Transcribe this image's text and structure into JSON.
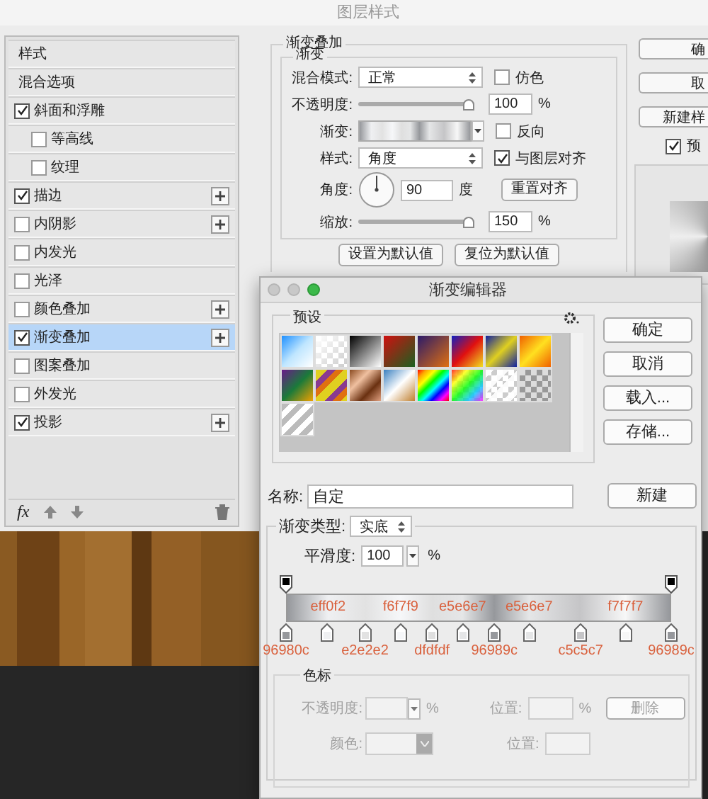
{
  "window": {
    "title": "图层样式"
  },
  "styles_list": {
    "items": [
      {
        "label": "样式",
        "kind": "header",
        "selected": false,
        "add_button": false
      },
      {
        "label": "混合选项",
        "kind": "header",
        "selected": false,
        "add_button": false
      },
      {
        "label": "斜面和浮雕",
        "kind": "effect",
        "checked": true,
        "selected": false,
        "add_button": false,
        "children": [
          {
            "label": "等高线",
            "kind": "effect",
            "checked": false,
            "selected": false,
            "add_button": false
          },
          {
            "label": "纹理",
            "kind": "effect",
            "checked": false,
            "selected": false,
            "add_button": false
          }
        ]
      },
      {
        "label": "描边",
        "kind": "effect",
        "checked": true,
        "selected": false,
        "add_button": true
      },
      {
        "label": "内阴影",
        "kind": "effect",
        "checked": false,
        "selected": false,
        "add_button": true
      },
      {
        "label": "内发光",
        "kind": "effect",
        "checked": false,
        "selected": false,
        "add_button": false
      },
      {
        "label": "光泽",
        "kind": "effect",
        "checked": false,
        "selected": false,
        "add_button": false
      },
      {
        "label": "颜色叠加",
        "kind": "effect",
        "checked": false,
        "selected": false,
        "add_button": true
      },
      {
        "label": "渐变叠加",
        "kind": "effect",
        "checked": true,
        "selected": true,
        "add_button": true
      },
      {
        "label": "图案叠加",
        "kind": "effect",
        "checked": false,
        "selected": false,
        "add_button": false
      },
      {
        "label": "外发光",
        "kind": "effect",
        "checked": false,
        "selected": false,
        "add_button": false
      },
      {
        "label": "投影",
        "kind": "effect",
        "checked": true,
        "selected": false,
        "add_button": true
      }
    ],
    "fx": "fx"
  },
  "gradient_overlay": {
    "title": "渐变叠加",
    "section": "渐变",
    "blend_mode": {
      "label": "混合模式:",
      "value": "正常"
    },
    "dither": {
      "label": "仿色",
      "checked": false
    },
    "opacity": {
      "label": "不透明度:",
      "level": 1,
      "value": "100",
      "unit": "%"
    },
    "gradient": {
      "label": "渐变:"
    },
    "reverse": {
      "label": "反向",
      "checked": false
    },
    "style": {
      "label": "样式:",
      "value": "角度"
    },
    "align_with_layer": {
      "label": "与图层对齐",
      "checked": true
    },
    "angle": {
      "label": "角度:",
      "value": "90",
      "unit": "度"
    },
    "reset_alignment": "重置对齐",
    "scale": {
      "label": "缩放:",
      "level": 1,
      "value": "150",
      "unit": "%"
    },
    "buttons": [
      "设置为默认值",
      "复位为默认值"
    ]
  },
  "side_buttons": [
    "确",
    "取",
    "新建样"
  ],
  "preview": {
    "label": "预",
    "checked": true
  },
  "gradient_editor": {
    "title": "渐变编辑器",
    "presets_label": "预设",
    "buttons": [
      "确定",
      "取消",
      "载入...",
      "存储..."
    ],
    "name": {
      "label": "名称:",
      "value": "自定"
    },
    "new_button": "新建",
    "type": {
      "label": "渐变类型:",
      "value": "实底"
    },
    "smoothness": {
      "label": "平滑度:",
      "value": "100",
      "unit": "%"
    },
    "color_stops": [
      {
        "color": "#96989c",
        "level": 0,
        "label": "96980c"
      },
      {
        "color": "#eff0f2",
        "level": 0.106,
        "label": "eff0f2"
      },
      {
        "color": "#e2e2e2",
        "level": 0.205,
        "label": "e2e2e2"
      },
      {
        "color": "#f6f7f9",
        "level": 0.296,
        "label": "f6f7f9"
      },
      {
        "color": "#dfdfdf",
        "level": 0.379,
        "label": "dfdfdf"
      },
      {
        "color": "#e5e6e7",
        "level": 0.458,
        "label": "e5e6e7"
      },
      {
        "color": "#96989c",
        "level": 0.541,
        "label": "96989c"
      },
      {
        "color": "#e5e6e7",
        "level": 0.632,
        "label": "e5e6e7"
      },
      {
        "color": "#c5c5c7",
        "level": 0.765,
        "label": "c5c5c7"
      },
      {
        "color": "#f7f7f7",
        "level": 0.884,
        "label": "f7f7f7"
      },
      {
        "color": "#96989c",
        "level": 1,
        "label": "96989c"
      }
    ],
    "stops_panel": {
      "title": "色标",
      "disabled": true,
      "opacity_label": "不透明度:",
      "opacity_unit": "%",
      "position_label": "位置:",
      "position_unit": "%",
      "delete": "删除",
      "color_label": "颜色:",
      "position2_label": "位置:"
    }
  }
}
